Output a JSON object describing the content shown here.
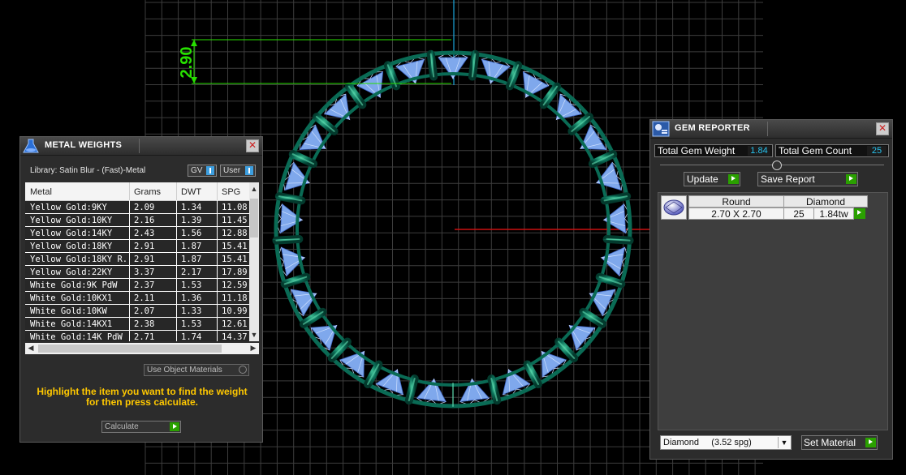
{
  "viewport": {
    "dimension_label": "2.90",
    "colors": {
      "grid": "#3d3d3d",
      "ring": "#0a6b55",
      "gem": "#7fa8ec",
      "axis_x": "#cc1111",
      "axis_y": "#1aa5d8",
      "dimension": "#27e000"
    },
    "gem_count": 25
  },
  "metal_weights": {
    "title": "METAL WEIGHTS",
    "library": "Library: Satin Blur - (Fast)-Metal",
    "toggle_gv": "GV",
    "toggle_user": "User",
    "columns": [
      "Metal",
      "Grams",
      "DWT",
      "SPG"
    ],
    "rows": [
      [
        "Yellow Gold:9KY",
        "2.09",
        "1.34",
        "11.08"
      ],
      [
        "Yellow Gold:10KY",
        "2.16",
        "1.39",
        "11.45"
      ],
      [
        "Yellow Gold:14KY",
        "2.43",
        "1.56",
        "12.88"
      ],
      [
        "Yellow Gold:18KY",
        "2.91",
        "1.87",
        "15.41"
      ],
      [
        "Yellow Gold:18KY R...",
        "2.91",
        "1.87",
        "15.41"
      ],
      [
        "Yellow Gold:22KY",
        "3.37",
        "2.17",
        "17.89"
      ],
      [
        "White Gold:9K PdW",
        "2.37",
        "1.53",
        "12.59"
      ],
      [
        "White Gold:10KX1",
        "2.11",
        "1.36",
        "11.18"
      ],
      [
        "White Gold:10KW",
        "2.07",
        "1.33",
        "10.99"
      ],
      [
        "White Gold:14KX1",
        "2.38",
        "1.53",
        "12.61"
      ],
      [
        "White Gold:14K PdW",
        "2.71",
        "1.74",
        "14.37"
      ]
    ],
    "use_object_materials": "Use Object Materials",
    "hint": "Highlight the item you want to find the weight for then press calculate.",
    "calculate_label": "Calculate"
  },
  "gem_reporter": {
    "title": "GEM REPORTER",
    "total_weight_label": "Total Gem Weight",
    "total_weight_value": "1.84",
    "total_count_label": "Total Gem Count",
    "total_count_value": "25",
    "update_label": "Update",
    "save_report_label": "Save Report",
    "table": {
      "shape_header": "Round",
      "material_header": "Diamond",
      "size": "2.70 X 2.70",
      "count": "25",
      "weight": "1.84tw"
    },
    "material_select": "Diamond     (3.52 spg)",
    "set_material_label": "Set Material"
  }
}
